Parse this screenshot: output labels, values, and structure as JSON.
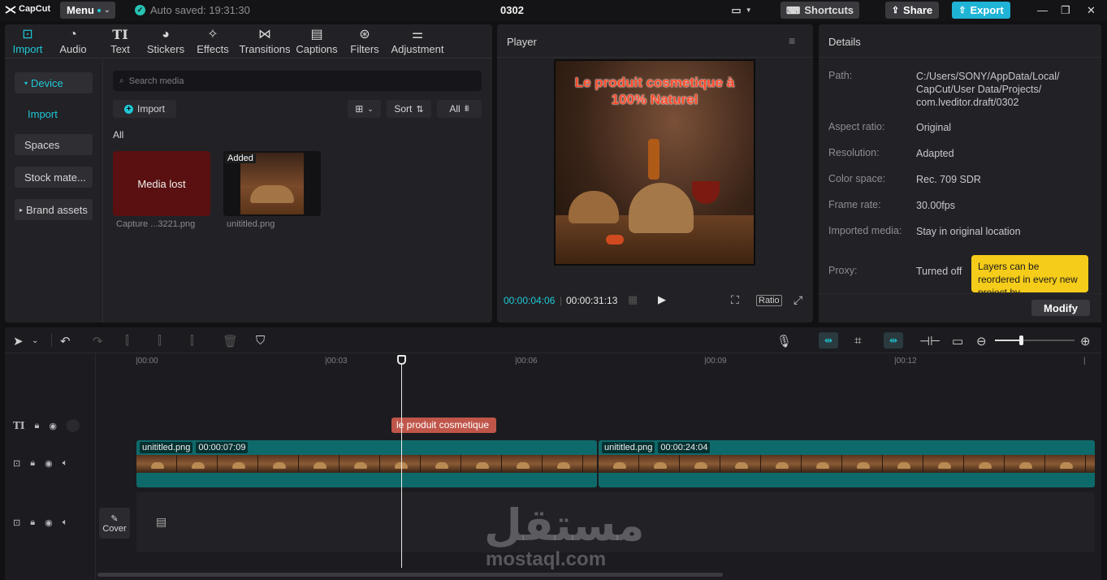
{
  "app": {
    "logo": "CapCut",
    "menu_label": "Menu",
    "autosave": "Auto saved: 19:31:30",
    "project_title": "0302",
    "shortcuts_label": "Shortcuts",
    "share_label": "Share",
    "export_label": "Export"
  },
  "media_tabs": [
    {
      "label": "Import",
      "icon": "import-icon"
    },
    {
      "label": "Audio",
      "icon": "audio-icon"
    },
    {
      "label": "Text",
      "icon": "text-icon"
    },
    {
      "label": "Stickers",
      "icon": "stickers-icon"
    },
    {
      "label": "Effects",
      "icon": "effects-icon"
    },
    {
      "label": "Transitions",
      "icon": "transitions-icon"
    },
    {
      "label": "Captions",
      "icon": "captions-icon"
    },
    {
      "label": "Filters",
      "icon": "filters-icon"
    },
    {
      "label": "Adjustment",
      "icon": "adjustment-icon"
    }
  ],
  "sidebar": {
    "device": "Device",
    "import": "Import",
    "spaces": "Spaces",
    "stock": "Stock mate...",
    "brand": "Brand assets"
  },
  "media": {
    "search_placeholder": "Search media",
    "import_label": "Import",
    "sort_label": "Sort",
    "filter_label": "All",
    "section_label": "All",
    "items": [
      {
        "overlay": "Media lost",
        "caption": "Capture ...3221.png"
      },
      {
        "overlay": "Added",
        "caption": "unititled.png"
      }
    ]
  },
  "player": {
    "title": "Player",
    "overlay_text": "Le produit cosmetique à 100% Naturel",
    "current_time": "00:00:04:06",
    "total_time": "00:00:31:13",
    "ratio_label": "Ratio"
  },
  "details": {
    "title": "Details",
    "rows": [
      {
        "key": "Path:",
        "value": "C:/Users/SONY/AppData/Local/\nCapCut/User Data/Projects/\ncom.lveditor.draft/0302"
      },
      {
        "key": "Aspect ratio:",
        "value": "Original"
      },
      {
        "key": "Resolution:",
        "value": "Adapted"
      },
      {
        "key": "Color space:",
        "value": "Rec. 709 SDR"
      },
      {
        "key": "Frame rate:",
        "value": "30.00fps"
      },
      {
        "key": "Imported media:",
        "value": "Stay in original location"
      },
      {
        "key": "Proxy:",
        "value": "Turned off"
      }
    ],
    "tooltip": "Layers can be reordered in every new project by",
    "modify_label": "Modify"
  },
  "timeline": {
    "ruler": [
      "|00:00",
      "|00:03",
      "|00:06",
      "|00:09",
      "|00:12"
    ],
    "text_clip": "le produit cosmetique",
    "clips": [
      {
        "name": "unititled.png",
        "duration": "00:00:07:09"
      },
      {
        "name": "unititled.png",
        "duration": "00:00:24:04"
      }
    ],
    "cover_label": "Cover",
    "playhead_fraction": 0.14
  },
  "watermark": {
    "arabic": "مستقل",
    "latin": "mostaql.com"
  },
  "colors": {
    "accent": "#1fc8d6",
    "export": "#1fb4d6",
    "text_clip": "#c0564a",
    "video_clip": "#0e6a6a",
    "tooltip": "#f5cc1a"
  }
}
